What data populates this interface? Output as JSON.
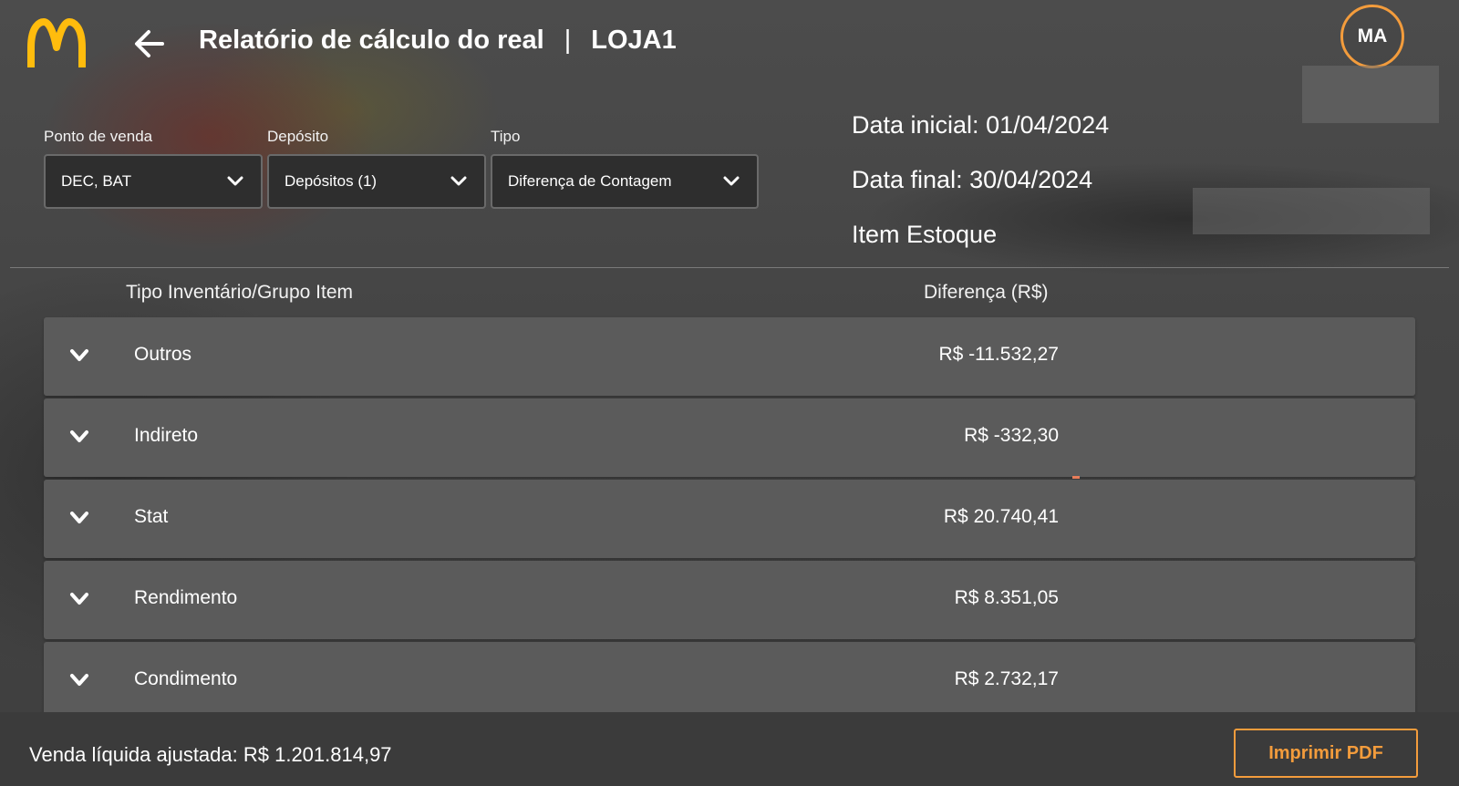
{
  "header": {
    "title": "Relatório de cálculo do real",
    "separator": "|",
    "store": "LOJA1",
    "avatar_initials": "MA",
    "logo_icon": "mcdonalds-arches-logo",
    "back_icon": "arrow-left-icon"
  },
  "filters": [
    {
      "label": "Ponto de venda",
      "value": "DEC, BAT"
    },
    {
      "label": "Depósito",
      "value": "Depósitos (1)"
    },
    {
      "label": "Tipo",
      "value": "Diferença de Contagem"
    }
  ],
  "info": {
    "start_date": "Data inicial: 01/04/2024",
    "end_date": "Data final: 30/04/2024",
    "item": "Item Estoque"
  },
  "table": {
    "col_group": "Tipo Inventário/Grupo Item",
    "col_diff": "Diferença (R$)",
    "rows": [
      {
        "name": "Outros",
        "amount": "R$ -11.532,27"
      },
      {
        "name": "Indireto",
        "amount": "R$ -332,30"
      },
      {
        "name": "Stat",
        "amount": "R$ 20.740,41"
      },
      {
        "name": "Rendimento",
        "amount": "R$ 8.351,05"
      },
      {
        "name": "Condimento",
        "amount": "R$ 2.732,17"
      }
    ]
  },
  "footer": {
    "net_sales": "Venda líquida ajustada: R$ 1.201.814,97",
    "print_button": "Imprimir PDF"
  },
  "colors": {
    "accent": "#f39c3c",
    "logo": "#ffbc0d",
    "row_bg": "#5b5b5b",
    "footer_bg": "#3b3b3b"
  }
}
